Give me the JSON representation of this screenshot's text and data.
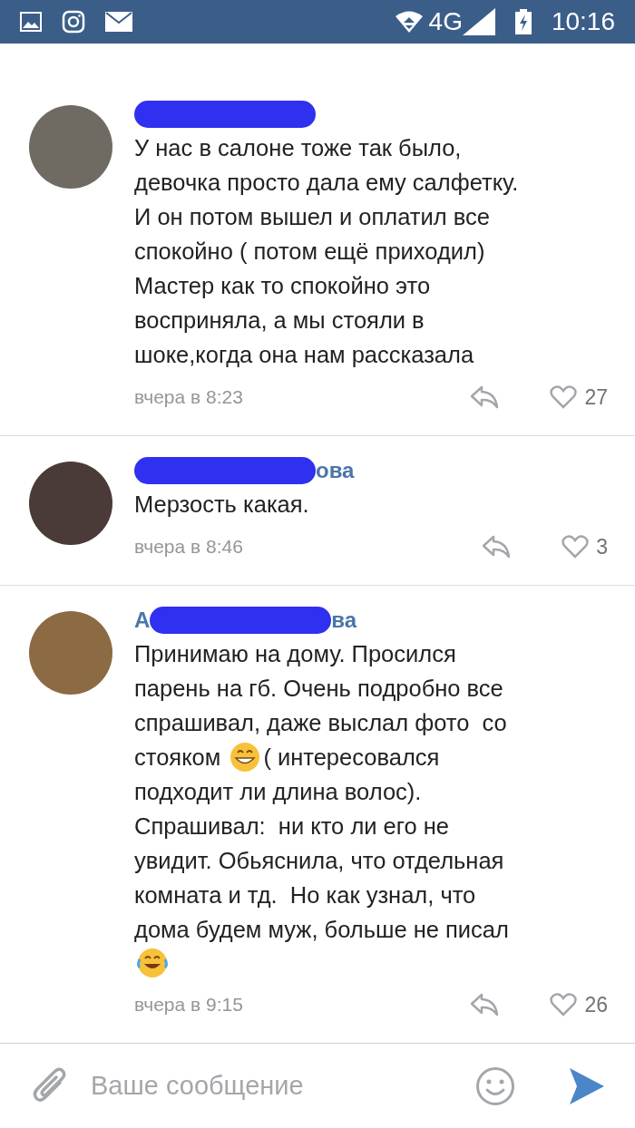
{
  "status_bar": {
    "network": "4G",
    "time": "10:16"
  },
  "comments": [
    {
      "redacted": true,
      "lines": [
        [
          {
            "kind": "text",
            "text": "У нас в салоне тоже так было,"
          }
        ],
        [
          {
            "kind": "text",
            "text": "девочка просто дала ему салфетку."
          }
        ],
        [
          {
            "kind": "text",
            "text": "И он потом вышел и оплатил все"
          }
        ],
        [
          {
            "kind": "text",
            "text": "спокойно ( потом ещё приходил)"
          }
        ],
        [
          {
            "kind": "text",
            "text": "Мастер как то спокойно это"
          }
        ],
        [
          {
            "kind": "text",
            "text": "восприняла, а мы стояли в"
          }
        ],
        [
          {
            "kind": "text",
            "text": "шоке,когда она нам рассказала"
          }
        ]
      ],
      "time": "вчера в 8:23",
      "likes": "27"
    },
    {
      "redacted": true,
      "name_tail": "ова",
      "lines": [
        [
          {
            "kind": "text",
            "text": "Мерзость какая."
          }
        ]
      ],
      "time": "вчера в 8:46",
      "likes": "3"
    },
    {
      "redacted": true,
      "name_head": "А",
      "name_tail": "ва",
      "lines": [
        [
          {
            "kind": "text",
            "text": "Принимаю на дому. Просился"
          }
        ],
        [
          {
            "kind": "text",
            "text": "парень на гб. Очень подробно все"
          }
        ],
        [
          {
            "kind": "text",
            "text": "спрашивал, даже выслал фото  со"
          }
        ],
        [
          {
            "kind": "text",
            "text": "стояком "
          },
          {
            "kind": "grin"
          },
          {
            "kind": "text",
            "text": "( интересовался"
          }
        ],
        [
          {
            "kind": "text",
            "text": "подходит ли длина волос)."
          }
        ],
        [
          {
            "kind": "text",
            "text": "Спрашивал:  ни кто ли его не"
          }
        ],
        [
          {
            "kind": "text",
            "text": "увидит. Обьяснила, что отдельная"
          }
        ],
        [
          {
            "kind": "text",
            "text": "комната и тд.  Но как узнал, что"
          }
        ],
        [
          {
            "kind": "text",
            "text": "дома будем муж, больше не писал"
          }
        ],
        [
          {
            "kind": "tears"
          }
        ]
      ],
      "time": "вчера в 9:15",
      "likes": "26"
    }
  ],
  "composer": {
    "placeholder": "Ваше сообщение"
  }
}
